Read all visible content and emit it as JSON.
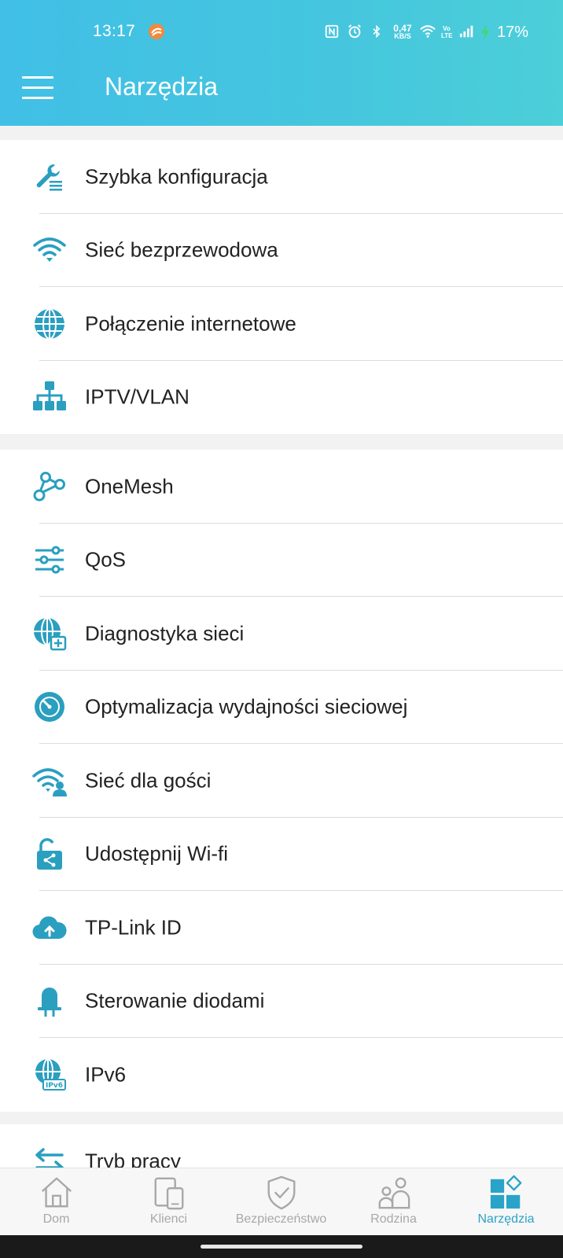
{
  "status_bar": {
    "time": "13:17",
    "net_speed_value": "0,47",
    "net_speed_unit": "KB/S",
    "volte_top": "Vo",
    "volte_bottom": "LTE",
    "battery": "17%"
  },
  "header": {
    "title": "Narzędzia"
  },
  "sections": [
    {
      "items": [
        {
          "label": "Szybka konfiguracja",
          "icon": "wrench-icon"
        },
        {
          "label": "Sieć bezprzewodowa",
          "icon": "wifi-icon"
        },
        {
          "label": "Połączenie internetowe",
          "icon": "globe-icon"
        },
        {
          "label": "IPTV/VLAN",
          "icon": "network-tree-icon"
        }
      ]
    },
    {
      "items": [
        {
          "label": "OneMesh",
          "icon": "mesh-icon"
        },
        {
          "label": "QoS",
          "icon": "sliders-icon"
        },
        {
          "label": "Diagnostyka sieci",
          "icon": "globe-diagnostic-icon"
        },
        {
          "label": "Optymalizacja wydajności sieciowej",
          "icon": "speedometer-icon"
        },
        {
          "label": "Sieć dla gości",
          "icon": "guest-wifi-icon"
        },
        {
          "label": "Udostępnij Wi-fi",
          "icon": "share-lock-icon"
        },
        {
          "label": "TP-Link ID",
          "icon": "cloud-upload-icon"
        },
        {
          "label": "Sterowanie diodami",
          "icon": "led-icon"
        },
        {
          "label": "IPv6",
          "icon": "globe-ipv6-icon"
        }
      ]
    },
    {
      "items": [
        {
          "label": "Tryb pracy",
          "icon": "swap-arrows-icon"
        }
      ]
    }
  ],
  "bottom_nav": {
    "items": [
      {
        "label": "Dom",
        "icon": "home-icon",
        "active": false
      },
      {
        "label": "Klienci",
        "icon": "devices-icon",
        "active": false
      },
      {
        "label": "Bezpieczeństwo",
        "icon": "shield-icon",
        "active": false
      },
      {
        "label": "Rodzina",
        "icon": "family-icon",
        "active": false
      },
      {
        "label": "Narzędzia",
        "icon": "tools-grid-icon",
        "active": true
      }
    ]
  },
  "colors": {
    "accent": "#2a9fc0",
    "header_start": "#41bfe6",
    "header_end": "#4ccfd8",
    "nav_inactive": "#a8a8a8",
    "nav_active": "#2aa3c8"
  }
}
